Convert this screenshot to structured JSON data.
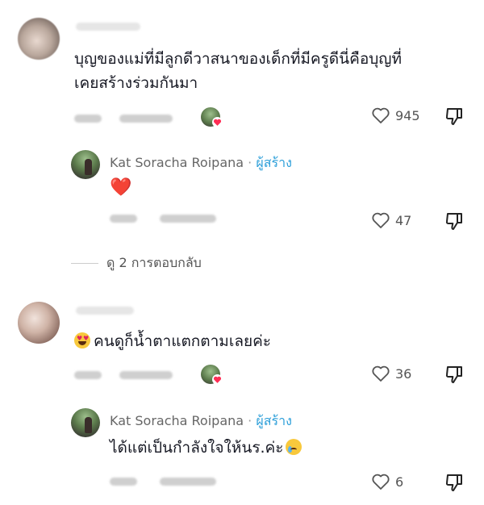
{
  "comments": [
    {
      "text_line1": "บุญของแม่ที่มีลูกดีวาสนาของเด็กที่มีครูดีนี่คือบุญที่",
      "text_line2": "เคยสร้างร่วมกันมา",
      "likes": "945",
      "reply": {
        "author": "Kat Soracha Roipana",
        "separator": "·",
        "creator_label": "ผู้สร้าง",
        "text": "❤️",
        "likes": "47"
      },
      "view_replies": "ดู 2 การตอบกลับ"
    },
    {
      "text": "คนดูก็น้ำตาแตกตามเลยค่ะ",
      "emoji": "heart-eyes-face",
      "likes": "36",
      "reply": {
        "author": "Kat Soracha Roipana",
        "separator": "·",
        "creator_label": "ผู้สร้าง",
        "text": "ได้แต่เป็นกำลังใจให้นร.ค่ะ",
        "emoji": "crying-face",
        "likes": "6"
      }
    }
  ],
  "colors": {
    "creator": "#2d9fd9",
    "heart": "#e02424",
    "meta": "#555555"
  }
}
